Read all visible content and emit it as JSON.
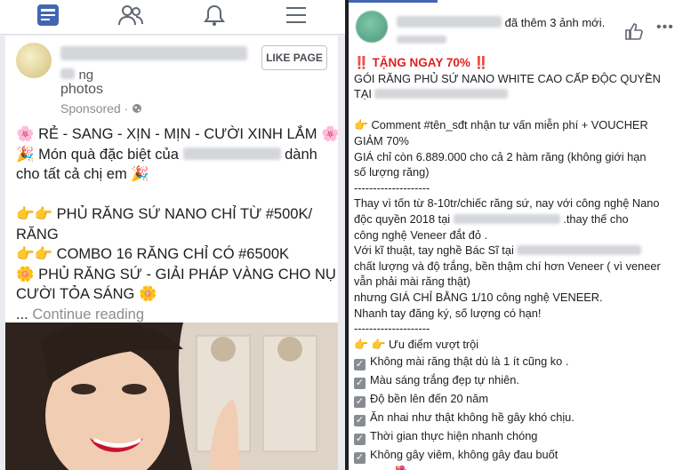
{
  "left_post": {
    "like_page_label": "LIKE PAGE",
    "name_suffix": "ng",
    "photos_label": "photos",
    "sponsored_label": "Sponsored",
    "lines": [
      "🌸 RẺ - SANG - XỊN - MỊN - CƯỜI XINH LẮM 🌸",
      "🎉 Món quà đặc biệt của",
      "dành",
      "cho tất cả chị em 🎉",
      "",
      "👉👉 PHỦ RĂNG SỨ NANO CHỈ TỪ #500K/",
      "RĂNG",
      "👉👉 COMBO 16 RĂNG CHỈ CÓ #6500K",
      "🌼 PHỦ RĂNG SỨ - GIẢI PHÁP VÀNG CHO NỤ",
      "CƯỜI TỎA SÁNG 🌼"
    ],
    "ellipsis": "...",
    "continue_reading": "Continue reading"
  },
  "right_post": {
    "added_photos": "đã thêm 3 ảnh mới.",
    "lines": [
      "‼️ TẶNG NGAY 70% ‼️",
      "GÓI RĂNG PHỦ SỨ NANO WHITE CAO CẤP ĐỘC QUYỀN",
      "TẠI",
      "",
      "👉 Comment #tên_sđt nhận tư vấn miễn phí + VOUCHER",
      "GIẢM 70%",
      "GIÁ chỉ còn 6.889.000 cho cả 2 hàm răng (không giới hạn",
      "số lượng răng)",
      "--------------------",
      "Thay vì tốn từ 8-10tr/chiếc răng sứ, nay với công nghệ Nano",
      "độc quyền 2018 tại",
      ".thay thế cho",
      "công nghệ Veneer đắt đỏ .",
      "Với kĩ thuật, tay nghề Bác Sĩ tại",
      "chất lượng và độ trắng, bền thậm chí hơn Veneer ( vì veneer",
      "vẫn phải mài răng thật)",
      "nhưng GIÁ CHỈ BẰNG 1/10 công nghệ VENEER.",
      "Nhanh tay đăng ký, số lượng có hạn!",
      "--------------------",
      "👉 👉 Ưu điểm vượt trội"
    ],
    "benefits": [
      "Không mài răng thật dù là 1 ít cũng ko .",
      "Màu sáng trắng đẹp tự nhiên.",
      "Độ bền lên đến 20 năm",
      "Ăn nhai như thật không hề gây khó chịu.",
      "Thời gian thực hiện nhanh chóng",
      "Không gây viêm, không gây đau buốt"
    ],
    "separator": "======🌺======"
  }
}
